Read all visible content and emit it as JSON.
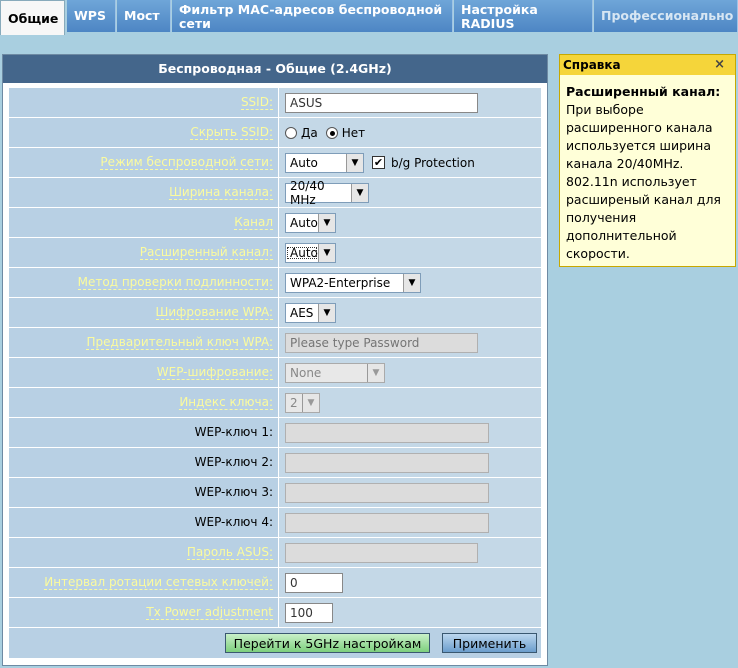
{
  "tabs": [
    {
      "label": "Общие"
    },
    {
      "label": "WPS"
    },
    {
      "label": "Мост"
    },
    {
      "label": "Фильтр MAC-адресов беспроводной сети"
    },
    {
      "label": "Настройка RADIUS"
    },
    {
      "label": "Профессионально"
    }
  ],
  "panel": {
    "title": "Беспроводная - Общие (2.4GHz)"
  },
  "fields": {
    "ssid": {
      "label": "SSID:",
      "value": "ASUS"
    },
    "hide_ssid": {
      "label": "Скрыть SSID:",
      "yes": "Да",
      "no": "Нет"
    },
    "mode": {
      "label": "Режим беспроводной сети:",
      "value": "Auto",
      "protection": "b/g Protection"
    },
    "bandwidth": {
      "label": "Ширина канала:",
      "value": "20/40 MHz"
    },
    "channel": {
      "label": "Канал",
      "value": "Auto"
    },
    "ext_channel": {
      "label": "Расширенный канал:",
      "value": "Auto"
    },
    "auth": {
      "label": "Метод проверки подлинности:",
      "value": "WPA2-Enterprise"
    },
    "wpa_enc": {
      "label": "Шифрование WPA:",
      "value": "AES"
    },
    "wpa_key": {
      "label": "Предварительный ключ WPA:",
      "placeholder": "Please type Password"
    },
    "wep_enc": {
      "label": "WEP-шифрование:",
      "value": "None"
    },
    "key_index": {
      "label": "Индекс ключа:",
      "value": "2"
    },
    "wep1": {
      "label": "WEP-ключ 1:"
    },
    "wep2": {
      "label": "WEP-ключ 2:"
    },
    "wep3": {
      "label": "WEP-ключ 3:"
    },
    "wep4": {
      "label": "WEP-ключ 4:"
    },
    "asus_pass": {
      "label": "Пароль ASUS:"
    },
    "rotation": {
      "label": "Интервал ротации сетевых ключей:",
      "value": "0"
    },
    "txpower": {
      "label": "Tx Power adjustment",
      "value": "100"
    }
  },
  "buttons": {
    "goto5g": "Перейти к 5GHz настройкам",
    "apply": "Применить"
  },
  "help": {
    "title": "Справка",
    "close": "×",
    "heading": "Расширенный канал:",
    "text": "При выборе расширенного канала используется ширина канала 20/40MHz. 802.11n использует расширеный канал для получения дополнительной скорости."
  }
}
